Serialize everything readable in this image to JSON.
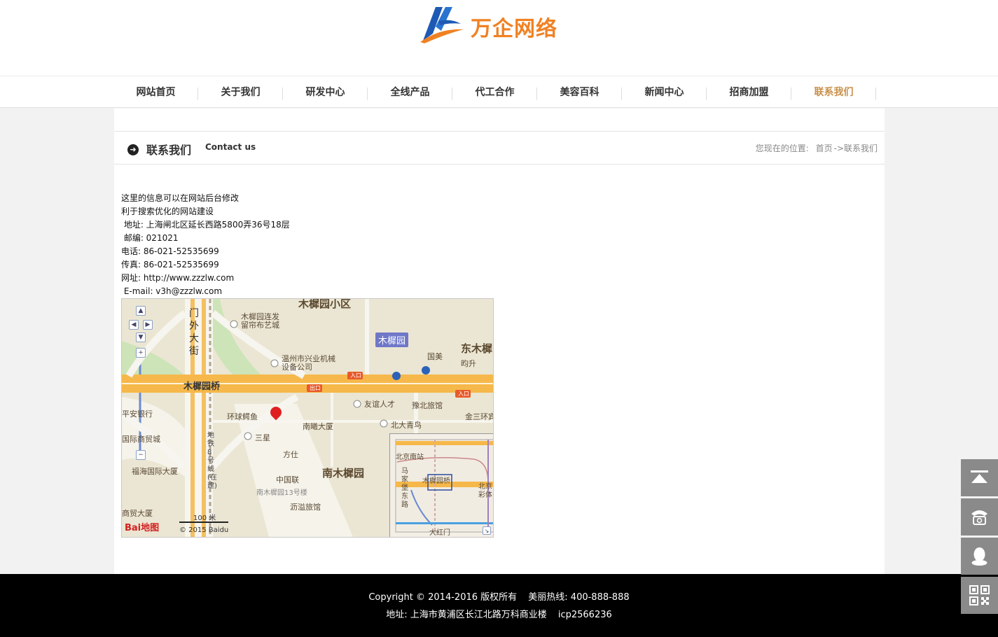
{
  "brand": {
    "name": "万企网络",
    "colors": {
      "orange": "#f08123",
      "blue": "#1e5ab4"
    }
  },
  "nav": {
    "items": [
      {
        "label": "网站首页"
      },
      {
        "label": "关于我们"
      },
      {
        "label": "研发中心"
      },
      {
        "label": "全线产品"
      },
      {
        "label": "代工合作"
      },
      {
        "label": "美容百科"
      },
      {
        "label": "新闻中心"
      },
      {
        "label": "招商加盟"
      },
      {
        "label": "联系我们",
        "active": true
      }
    ],
    "active_color": "#c8904a"
  },
  "page": {
    "title_cn": "联系我们",
    "title_en": "Contact us",
    "breadcrumb": {
      "prefix": "您现在的位置:",
      "home": "首页",
      "current": "->联系我们"
    }
  },
  "contact": {
    "lines": [
      "这里的信息可以在网站后台修改",
      "利于搜索优化的网站建设",
      " 地址: 上海闸北区延长西路5800弄36号18层",
      " 邮编: 021021",
      "电话: 86-021-52535699",
      "传真: 86-021-52535699",
      "网址: http://www.zzzlw.com",
      " E-mail: v3h@zzzlw.com"
    ]
  },
  "map": {
    "labels": {
      "area_north": "木樨园小区",
      "station": "木樨园",
      "east": "东木樨",
      "bridge": "木樨园桥",
      "south": "南木樨园",
      "street_1": "门",
      "street_2": "外",
      "street_3": "大",
      "street_4": "街",
      "poi_1": "温州市兴业机械设备公司",
      "poi_2": "木樨园连发留帘布艺城",
      "poi_3": "友谊人才",
      "poi_4": "豫北旅馆",
      "poi_5": "北大青鸟",
      "poi_6": "金三环宾",
      "poi_7": "环球鳄鱼",
      "poi_8": "南曦大厦",
      "poi_9": "三星",
      "poi_10": "方仕",
      "poi_11": "中国联",
      "poi_12": "南木樨园13号楼",
      "poi_13": "沥溢旅馆",
      "poi_14": "平安银行",
      "poi_15": "国际商贸城",
      "poi_16": "福海国际大厦",
      "poi_17": "商贸大厦",
      "poi_18": "国美",
      "poi_19": "昀升",
      "exit": "出口",
      "entry": "入口",
      "subway": "地铁8号线(在建)",
      "overview_station": "北京南站",
      "overview_bridge": "木樨园桥",
      "overview_road": "马家堡东路",
      "overview_south": "大红门",
      "overview_east": "北京彩体"
    },
    "scale": "100 米",
    "copyright": "© 2015 Baidu",
    "logo": "Bai地图"
  },
  "footer": {
    "copyright": "Copyright © 2014-2016 版权所有",
    "hotline": "美丽热线: 400-888-888",
    "address": "地址: 上海市黄浦区长江北路万科商业楼",
    "icp": "icp2566236"
  },
  "side_tools": {
    "icons": [
      "back-to-top-icon",
      "phone-icon",
      "qq-icon",
      "qr-code-icon"
    ]
  }
}
